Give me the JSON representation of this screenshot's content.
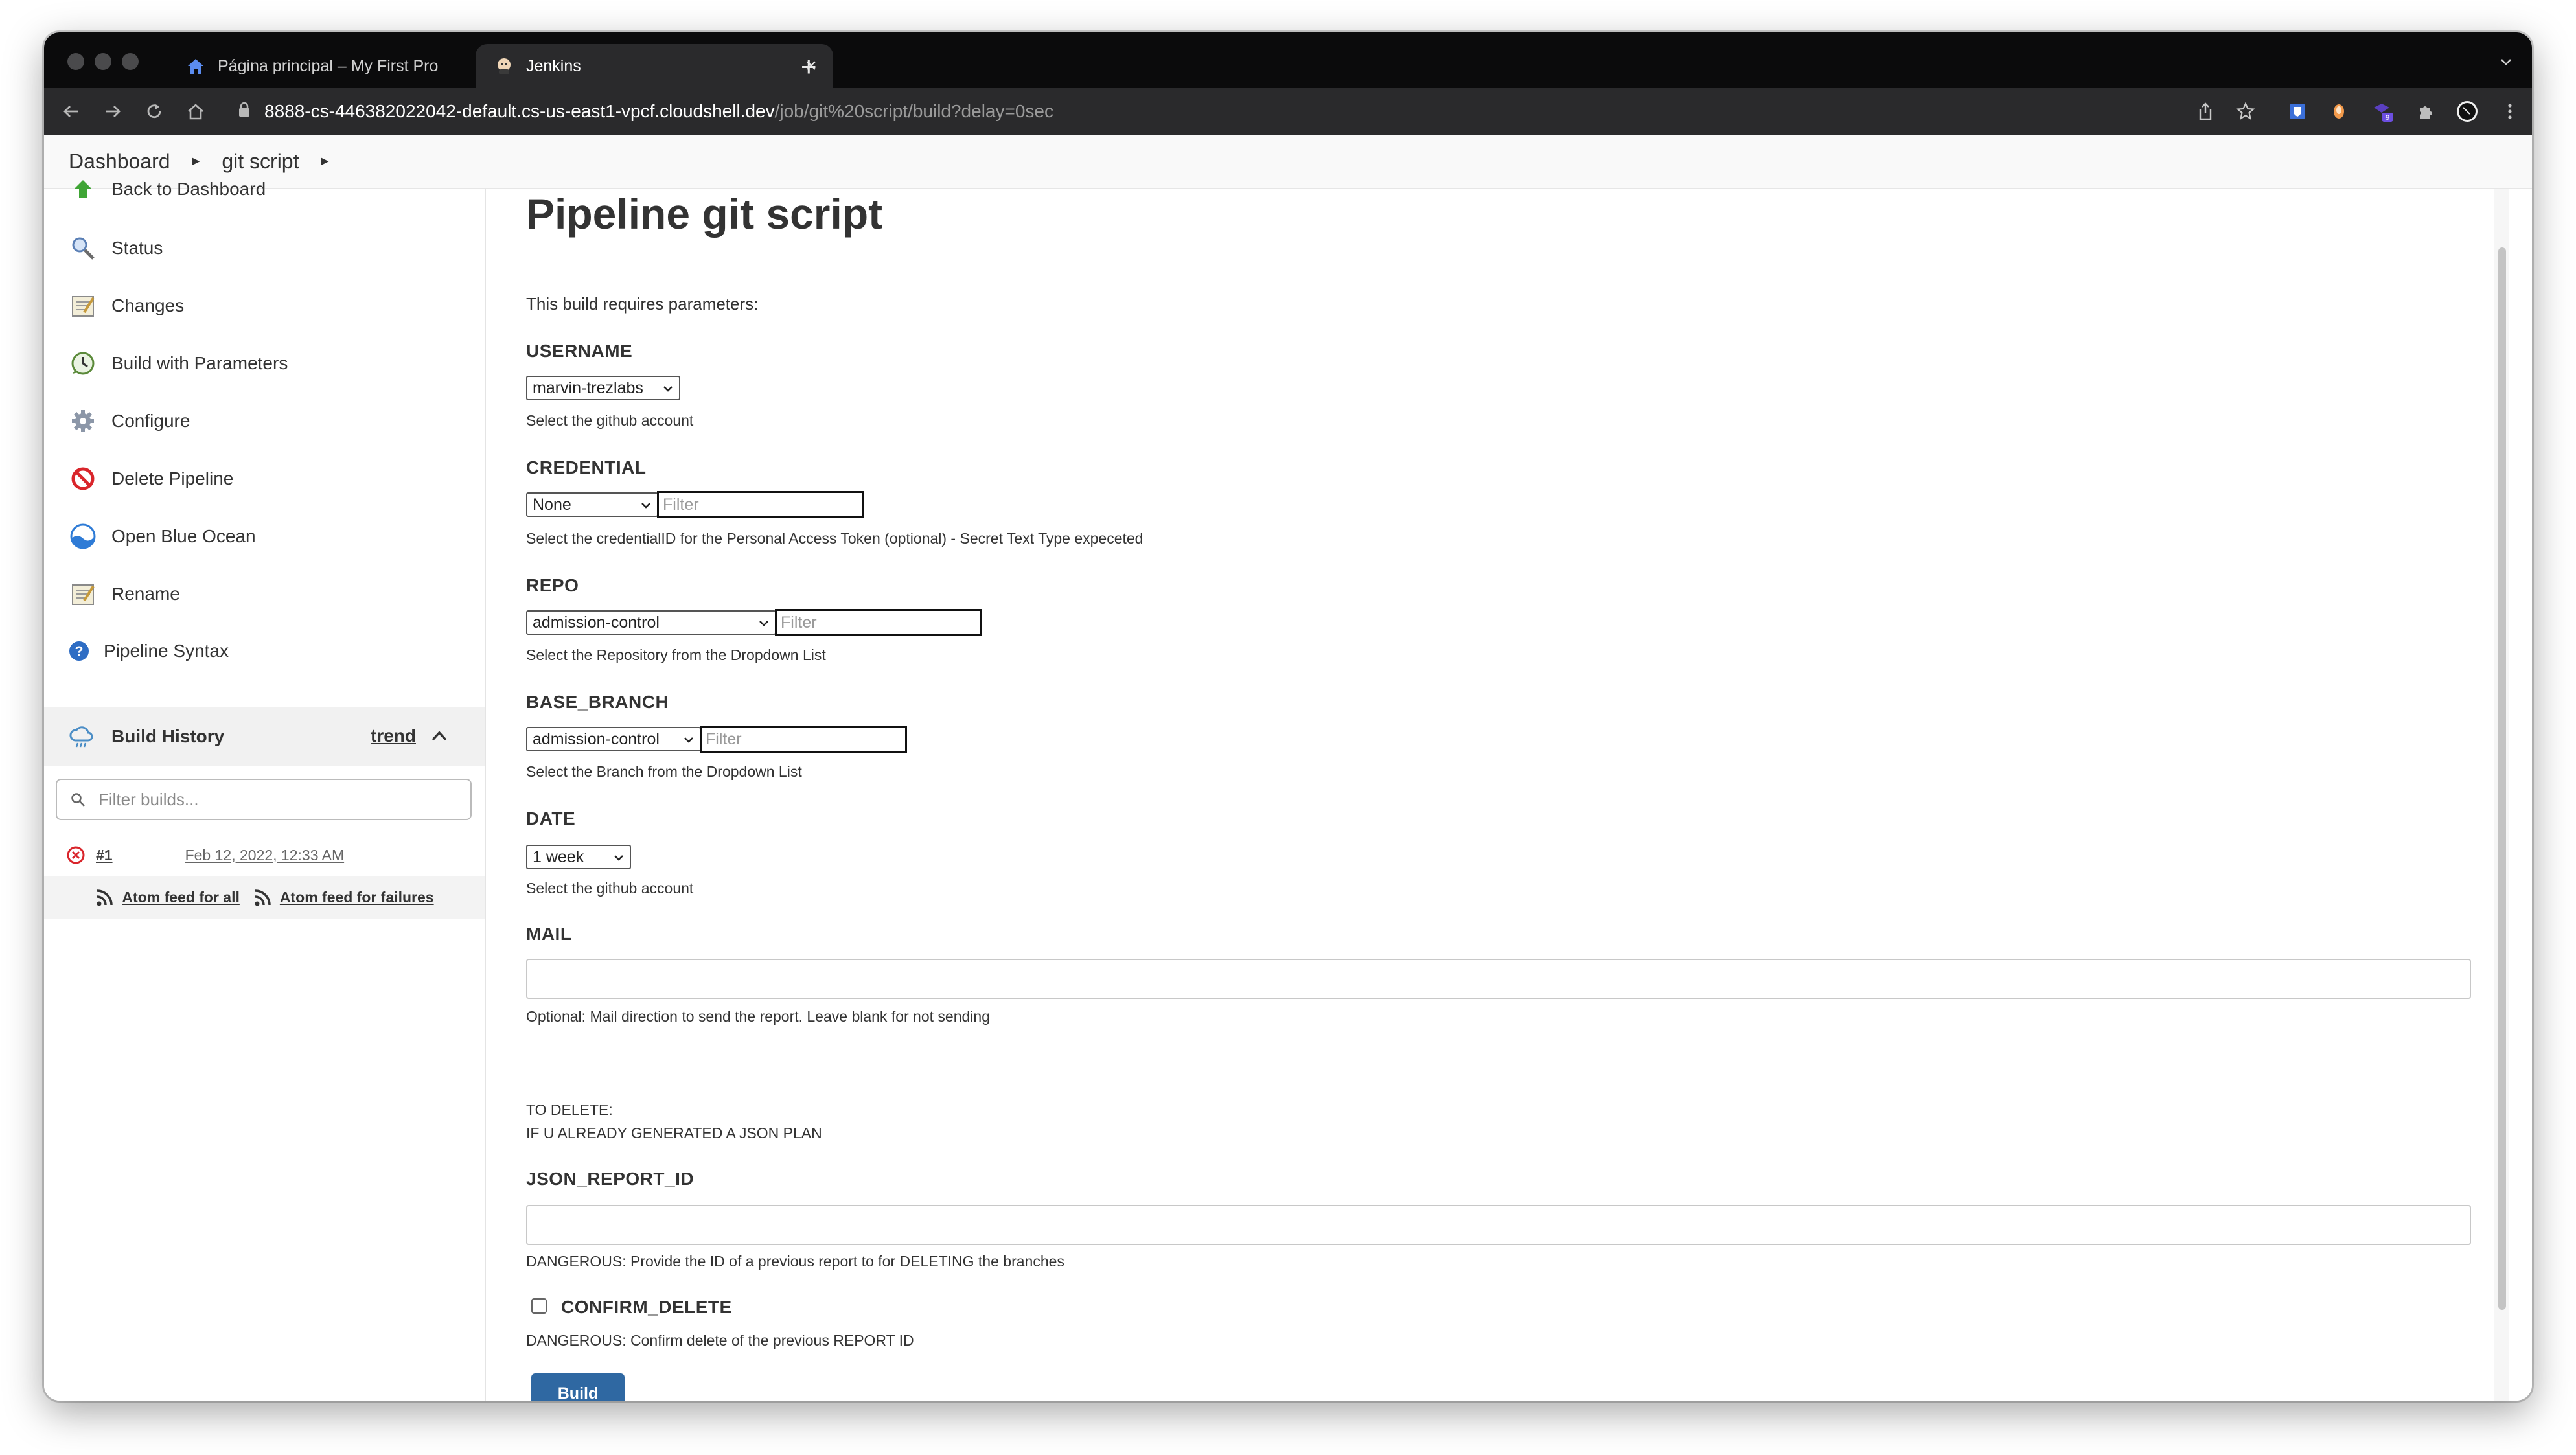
{
  "browser": {
    "tabs": [
      {
        "label": "Página principal – My First Pro",
        "icon": "home-icon",
        "active": false
      },
      {
        "label": "Jenkins",
        "icon": "jenkins-icon",
        "active": true
      }
    ],
    "url_host": "8888-cs-446382022042-default.cs-us-east1-vpcf.cloudshell.dev",
    "url_path": "/job/git%20script/build?delay=0sec"
  },
  "breadcrumbs": [
    "Dashboard",
    "git script"
  ],
  "sidebar": {
    "tasks": [
      {
        "label": "Back to Dashboard",
        "icon": "up-arrow-icon"
      },
      {
        "label": "Status",
        "icon": "magnifier-icon"
      },
      {
        "label": "Changes",
        "icon": "notepad-icon"
      },
      {
        "label": "Build with Parameters",
        "icon": "clock-build-icon"
      },
      {
        "label": "Configure",
        "icon": "gear-icon"
      },
      {
        "label": "Delete Pipeline",
        "icon": "no-entry-icon"
      },
      {
        "label": "Open Blue Ocean",
        "icon": "blue-ocean-icon"
      },
      {
        "label": "Rename",
        "icon": "notepad-icon"
      },
      {
        "label": "Pipeline Syntax",
        "icon": "help-icon"
      }
    ],
    "build_history": {
      "title": "Build History",
      "trend": "trend",
      "filter_placeholder": "Filter builds...",
      "builds": [
        {
          "number": "#1",
          "date": "Feb 12, 2022, 12:33 AM",
          "status": "failed"
        }
      ],
      "feed_all": "Atom feed for all",
      "feed_failures": "Atom feed for failures"
    }
  },
  "main": {
    "title": "Pipeline git script",
    "intro": "This build requires parameters:",
    "params": {
      "username": {
        "name": "USERNAME",
        "value": "marvin-trezlabs",
        "description": "Select the github account"
      },
      "credential": {
        "name": "CREDENTIAL",
        "value": "None",
        "filter_placeholder": "Filter",
        "description": "Select the credentialID for the Personal Access Token (optional) - Secret Text Type expeceted"
      },
      "repo": {
        "name": "REPO",
        "value": "admission-control",
        "filter_placeholder": "Filter",
        "description": "Select the Repository from the Dropdown List"
      },
      "base_branch": {
        "name": "BASE_BRANCH",
        "value": "admission-control",
        "filter_placeholder": "Filter",
        "description": "Select the Branch from the Dropdown List"
      },
      "date": {
        "name": "DATE",
        "value": "1 week",
        "description": "Select the github account"
      },
      "mail": {
        "name": "MAIL",
        "value": "",
        "description": "Optional: Mail direction to send the report. Leave blank for not sending"
      },
      "note_line1": "TO DELETE:",
      "note_line2": "IF U ALREADY GENERATED A JSON PLAN",
      "json_report_id": {
        "name": "JSON_REPORT_ID",
        "value": "",
        "description": "DANGEROUS: Provide the ID of a previous report to for DELETING the branches"
      },
      "confirm_delete": {
        "name": "CONFIRM_DELETE",
        "checked": false,
        "description": "DANGEROUS: Confirm delete of the previous REPORT ID"
      }
    },
    "build_label": "Build"
  },
  "colors": {
    "build_button": "#2f68a2",
    "failed_status": "#d9252b",
    "browser_titlebar": "#0b0b0c",
    "browser_toolbar": "#2a2a2c"
  }
}
